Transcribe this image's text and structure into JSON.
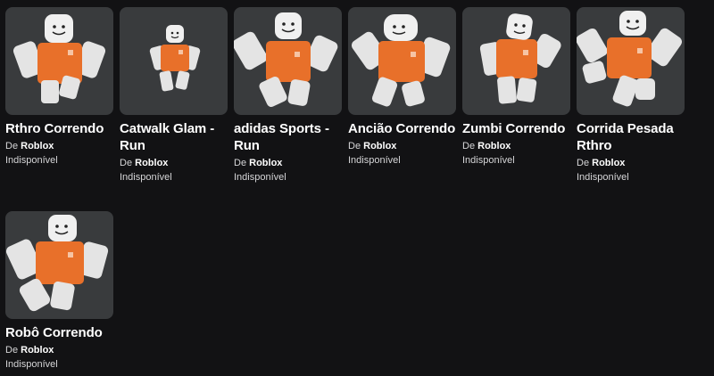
{
  "colors": {
    "background": "#121214",
    "thumb_bg": "#393b3d",
    "shirt": "#e8702a",
    "limb": "#e4e4e4"
  },
  "items": [
    {
      "title": "Rthro Correndo",
      "creator_prefix": "De",
      "creator": "Roblox",
      "status": "Indisponível"
    },
    {
      "title": "Catwalk Glam - Run",
      "creator_prefix": "De",
      "creator": "Roblox",
      "status": "Indisponível"
    },
    {
      "title": "adidas Sports - Run",
      "creator_prefix": "De",
      "creator": "Roblox",
      "status": "Indisponível"
    },
    {
      "title": "Ancião Correndo",
      "creator_prefix": "De",
      "creator": "Roblox",
      "status": "Indisponível"
    },
    {
      "title": "Zumbi Correndo",
      "creator_prefix": "De",
      "creator": "Roblox",
      "status": "Indisponível"
    },
    {
      "title": "Corrida Pesada Rthro",
      "creator_prefix": "De",
      "creator": "Roblox",
      "status": "Indisponível"
    },
    {
      "title": "Robô Correndo",
      "creator_prefix": "De",
      "creator": "Roblox",
      "status": "Indisponível"
    }
  ]
}
